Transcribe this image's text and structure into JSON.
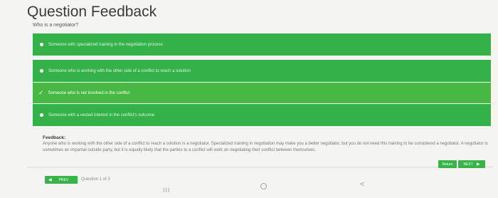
{
  "header": {
    "title": "Question Feedback"
  },
  "question": {
    "text": "Who is a negotiator?"
  },
  "answers": [
    {
      "text": "Someone with specialized training in the negotiation process",
      "selected": false
    },
    {
      "text": "Someone who is working with the other side of a conflict to reach a solution",
      "selected": false
    },
    {
      "text": "Someone who is not involved in the conflict",
      "selected": true
    },
    {
      "text": "Someone with a vested interest in the conflict's outcome",
      "selected": false
    }
  ],
  "feedback": {
    "label": "Feedback:",
    "text": "Anyone who is working with the other side of a conflict to reach a solution is a negotiator. Specialized training in negotiation may make you a better negotiator, but you do not need this training to be considered a negotiator. A negotiator is sometimes an impartial outside party, but it is equally likely that the parties to a conflict will work on negotiating their conflict between themselves."
  },
  "navigation": {
    "prev_label": "PREV",
    "counter": "Question 1 of 3",
    "return_label": "Return",
    "next_label": "NEXT"
  },
  "system_nav": {
    "recent": "III",
    "home": "O",
    "back": "<"
  },
  "colors": {
    "answer_bg": "#35b14a",
    "selected_bg": "#47b843",
    "button_bg": "#37b34a"
  }
}
